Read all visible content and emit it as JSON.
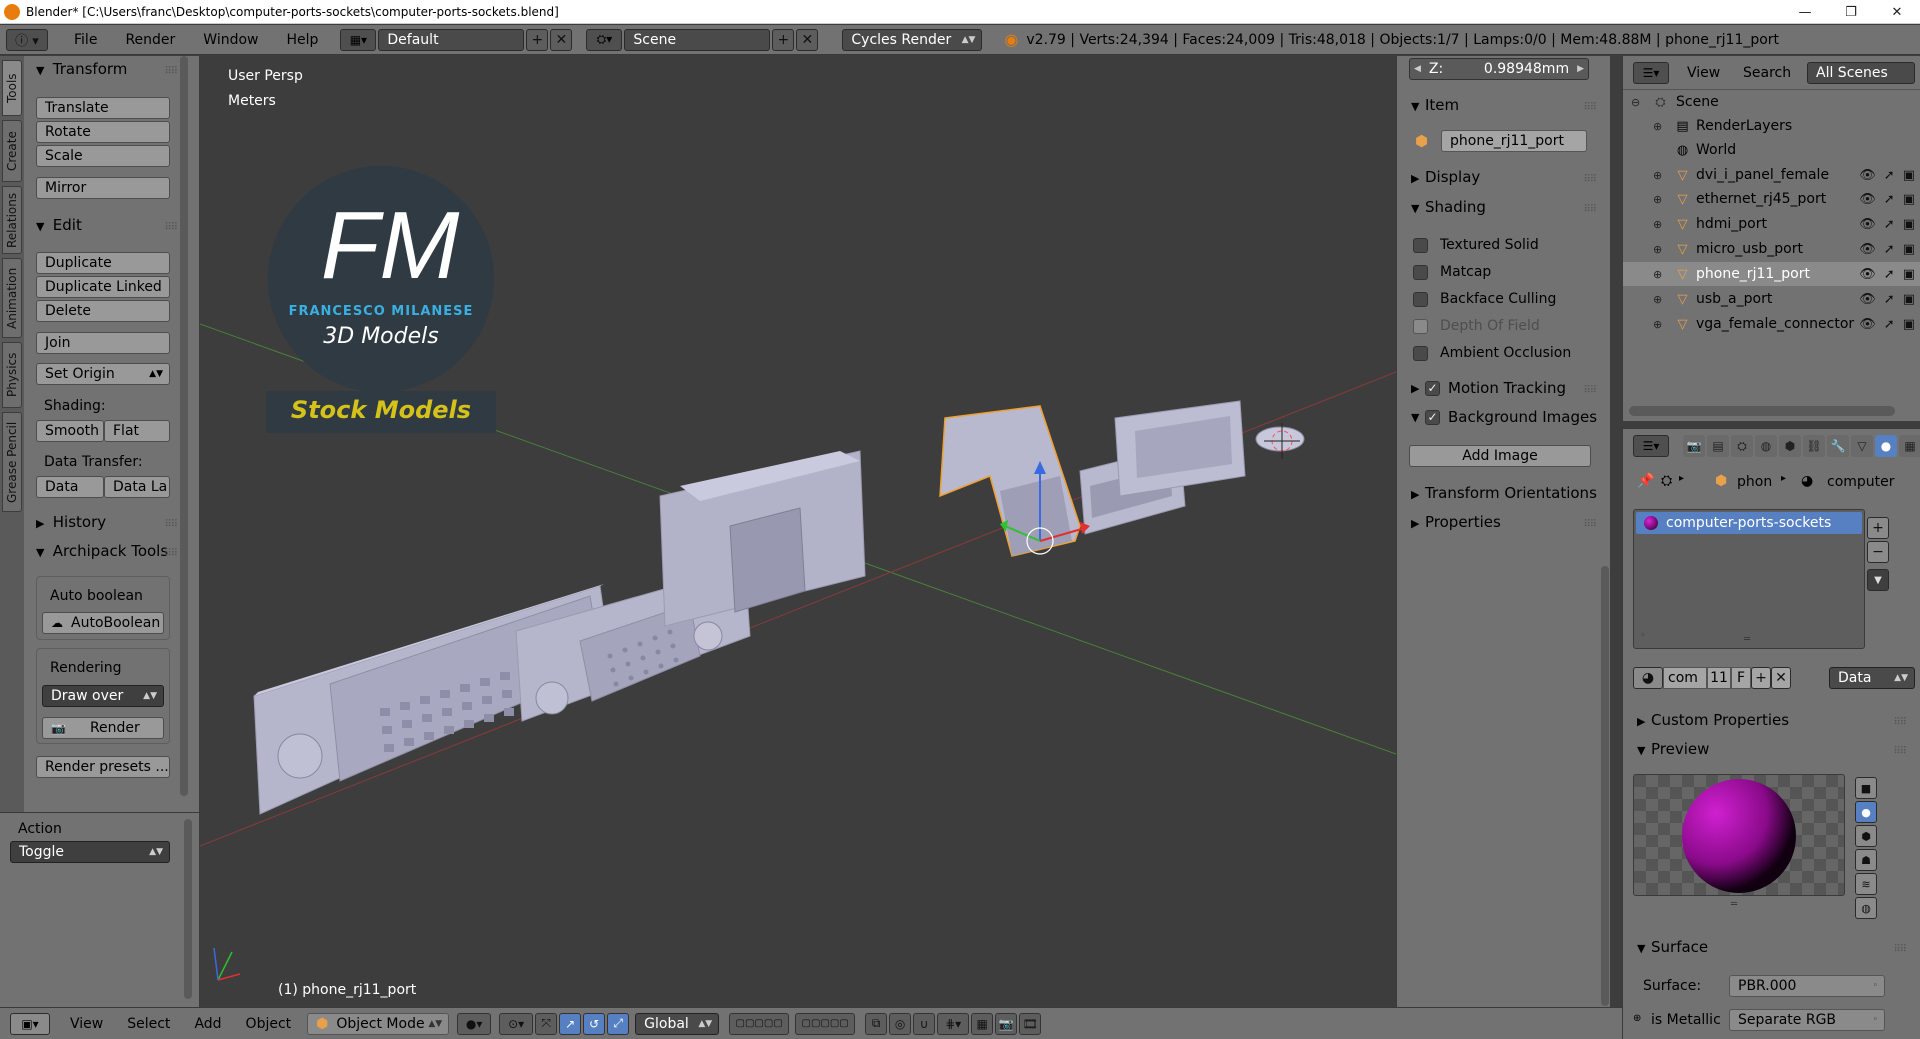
{
  "window": {
    "title": "Blender* [C:\\Users\\franc\\Desktop\\computer-ports-sockets\\computer-ports-sockets.blend]",
    "min": "—",
    "max": "❐",
    "close": "✕"
  },
  "menu": [
    "File",
    "Render",
    "Window",
    "Help"
  ],
  "header": {
    "layout": "Default",
    "scene": "Scene",
    "engine": "Cycles Render",
    "stats": "v2.79 | Verts:24,394 | Faces:24,009 | Tris:48,018 | Objects:1/7 | Lamps:0/0 | Mem:48.88M | phone_rj11_port"
  },
  "left_tabs": [
    "Tools",
    "Create",
    "Relations",
    "Animation",
    "Physics",
    "Grease Pencil"
  ],
  "tools": {
    "transform_header": "Transform",
    "translate": "Translate",
    "rotate": "Rotate",
    "scale": "Scale",
    "mirror": "Mirror",
    "edit_header": "Edit",
    "duplicate": "Duplicate",
    "duplicate_linked": "Duplicate Linked",
    "delete": "Delete",
    "join": "Join",
    "set_origin": "Set Origin",
    "shading_label": "Shading:",
    "smooth": "Smooth",
    "flat": "Flat",
    "data_transfer_label": "Data Transfer:",
    "data": "Data",
    "data_la": "Data La",
    "history_header": "History",
    "archipack_header": "Archipack Tools",
    "auto_boolean_label": "Auto boolean",
    "autoboolean_btn": "AutoBoolean",
    "rendering_label": "Rendering",
    "draw_over": "Draw over",
    "render_btn": "Render",
    "render_presets": "Render presets ..."
  },
  "action": {
    "label": "Action",
    "value": "Toggle"
  },
  "viewport": {
    "view_name": "User Persp",
    "units": "Meters",
    "logo_initials": "FM",
    "logo_name": "FRANCESCO MILANESE",
    "logo_sub": "3D Models",
    "logo_banner": "Stock Models",
    "object_label": "(1) phone_rj11_port"
  },
  "npanel": {
    "z_label": "Z:",
    "z_value": "0.98948mm",
    "item_header": "Item",
    "item_name": "phone_rj11_port",
    "display_header": "Display",
    "shading_header": "Shading",
    "textured_solid": "Textured Solid",
    "matcap": "Matcap",
    "backface_culling": "Backface Culling",
    "depth_of_field": "Depth Of Field",
    "ambient_occlusion": "Ambient Occlusion",
    "motion_tracking": "Motion Tracking",
    "background_images": "Background Images",
    "add_image": "Add Image",
    "transform_orientations": "Transform Orientations",
    "properties": "Properties"
  },
  "outliner": {
    "view": "View",
    "search": "Search",
    "all_scenes": "All Scenes",
    "scene": "Scene",
    "renderlayers": "RenderLayers",
    "world": "World",
    "objects": [
      "dvi_i_panel_female",
      "ethernet_rj45_port",
      "hdmi_port",
      "micro_usb_port",
      "phone_rj11_port",
      "usb_a_port",
      "vga_female_connector"
    ]
  },
  "props": {
    "crumb_obj": "phon",
    "crumb_mat": "computer",
    "material_slot": "computer-ports-sockets",
    "mat_name_short": "com",
    "mat_users": "11",
    "mat_f": "F",
    "link": "Data",
    "custom_properties": "Custom Properties",
    "preview": "Preview",
    "surface_header": "Surface",
    "surface_label": "Surface:",
    "surface_value": "PBR.000",
    "is_metallic": "is Metallic",
    "separate_rgb": "Separate RGB"
  },
  "bottom": {
    "view": "View",
    "select": "Select",
    "add": "Add",
    "object": "Object",
    "mode": "Object Mode",
    "orientation": "Global"
  },
  "colors": {
    "accent": "#5680c2",
    "selected_outline": "#f0a030",
    "logo_cyan": "#3ab0e0",
    "banner_text": "#d4c21a"
  }
}
